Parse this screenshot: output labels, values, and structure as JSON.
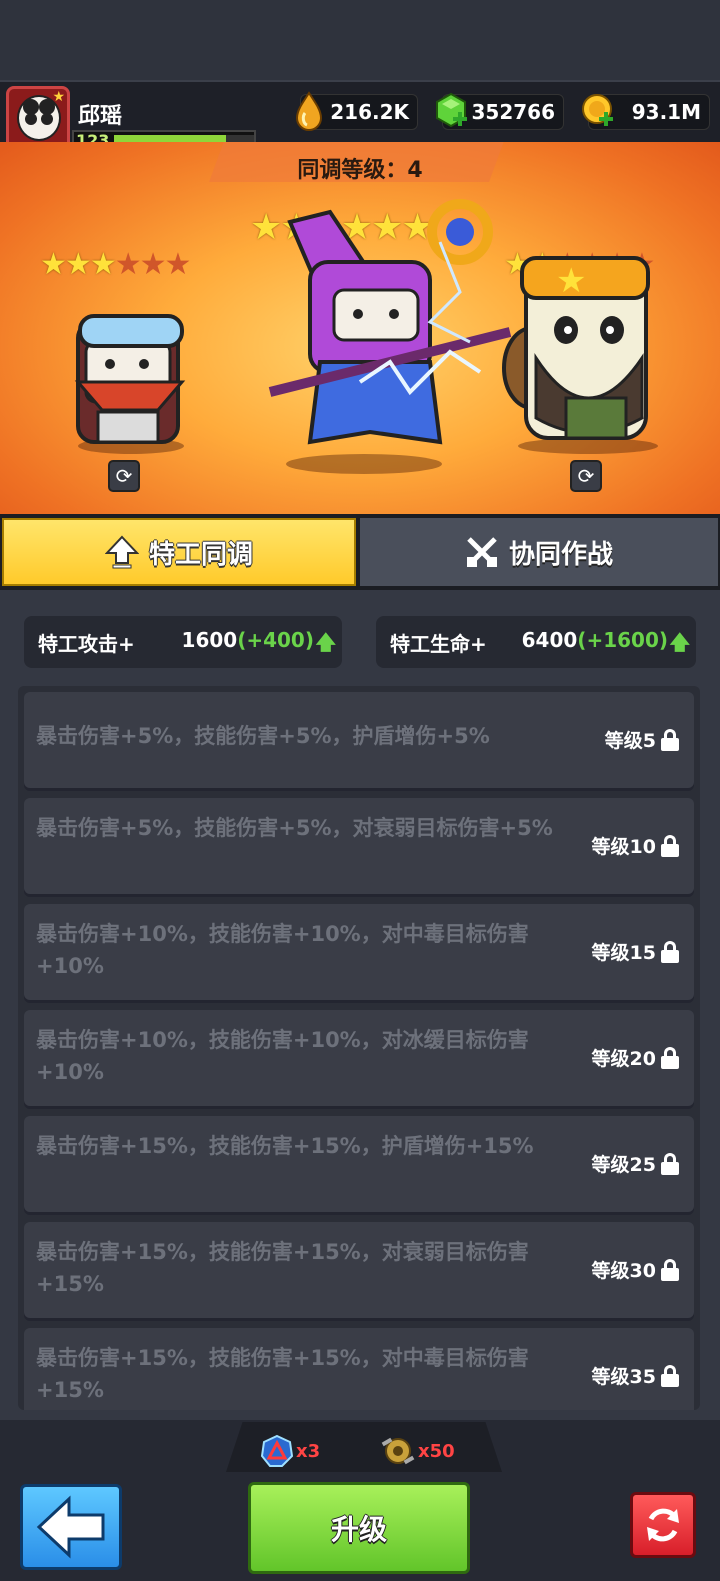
{
  "player": {
    "name": "邱瑶",
    "level": "123",
    "xp_fraction": 0.8
  },
  "resources": [
    {
      "icon": "energy-drop-icon",
      "value": "216.2K"
    },
    {
      "icon": "green-gem-icon",
      "value": "352766"
    },
    {
      "icon": "gold-coin-icon",
      "value": "93.1M"
    }
  ],
  "banner": {
    "sync_label": "同调等级：",
    "sync_value": "4",
    "heroes": [
      {
        "name": "left-hero",
        "stars": 3,
        "max_stars": 6
      },
      {
        "name": "center-hero",
        "stars": 6,
        "max_stars": 6
      },
      {
        "name": "right-hero",
        "stars": 2,
        "max_stars": 6
      }
    ]
  },
  "tabs": [
    {
      "label": "特工同调",
      "active": true
    },
    {
      "label": "协同作战",
      "active": false
    }
  ],
  "stats": [
    {
      "name": "特工攻击+",
      "value": "1600",
      "inc": "(+400)"
    },
    {
      "name": "特工生命+",
      "value": "6400",
      "inc": "(+1600)"
    }
  ],
  "bonuses": [
    {
      "text": "暴击伤害+5%，技能伤害+5%，护盾增伤+5%",
      "level": "等级5"
    },
    {
      "text": "暴击伤害+5%，技能伤害+5%，对衰弱目标伤害+5%",
      "level": "等级10"
    },
    {
      "text": "暴击伤害+10%，技能伤害+10%，对中毒目标伤害+10%",
      "level": "等级15"
    },
    {
      "text": "暴击伤害+10%，技能伤害+10%，对冰缓目标伤害+10%",
      "level": "等级20"
    },
    {
      "text": "暴击伤害+15%，技能伤害+15%，护盾增伤+15%",
      "level": "等级25"
    },
    {
      "text": "暴击伤害+15%，技能伤害+15%，对衰弱目标伤害+15%",
      "level": "等级30"
    },
    {
      "text": "暴击伤害+15%，技能伤害+15%，对中毒目标伤害+15%",
      "level": "等级35"
    }
  ],
  "costs": [
    {
      "icon": "sync-core-icon",
      "amount": "x3"
    },
    {
      "icon": "gear-part-icon",
      "amount": "x50"
    }
  ],
  "buttons": {
    "upgrade": "升级"
  }
}
